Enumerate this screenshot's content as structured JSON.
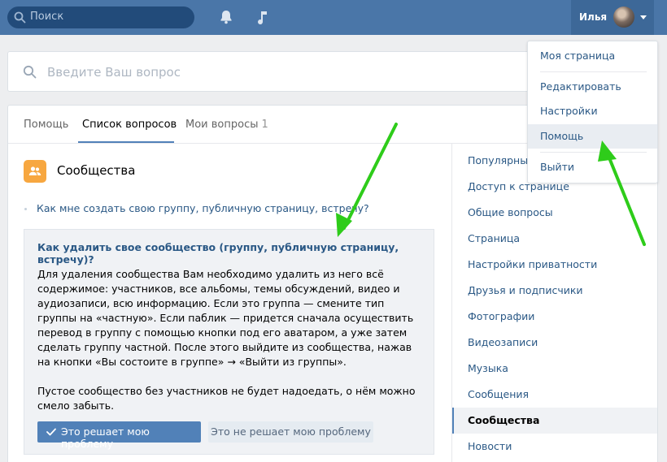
{
  "topbar": {
    "search_placeholder": "Поиск",
    "user_name": "Илья",
    "bg_color": "#4a76a8"
  },
  "help_search": {
    "placeholder": "Введите Ваш вопрос"
  },
  "tabs": [
    {
      "label": "Помощь",
      "active": false
    },
    {
      "label": "Список вопросов",
      "active": true
    },
    {
      "label": "Мои вопросы",
      "count": "1",
      "active": false
    }
  ],
  "section": {
    "title": "Сообщества",
    "question_link": "Как мне создать свою группу, публичную страницу, встречу?"
  },
  "answer": {
    "title": "Как удалить свое сообщество (группу, публичную страницу, встречу)?",
    "paragraph1": "Для удаления сообщества Вам необходимо удалить из него всё содержимое: участников, все альбомы, темы обсуждений, видео и аудиозаписи, всю информацию. Если это группа — смените тип группы на «частную». Если паблик — придется сначала осуществить перевод в группу с помощью кнопки под его аватаром, а уже затем сделать группу частной. После этого выйдите из сообщества, нажав на кнопки «Вы состоите в группе» → «Выйти из группы».",
    "paragraph2": "Пустое сообщество без участников не будет надоедать, о нём можно смело забыть.",
    "btn_yes": "Это решает мою проблему",
    "btn_no": "Это не решает мою проблему"
  },
  "side_menu": [
    "Популярные",
    "Доступ к странице",
    "Общие вопросы",
    "Страница",
    "Настройки приватности",
    "Друзья и подписчики",
    "Фотографии",
    "Видеозаписи",
    "Музыка",
    "Сообщения",
    "Сообщества",
    "Новости"
  ],
  "side_menu_active": "Сообщества",
  "dropdown": [
    "Моя страница",
    "Редактировать",
    "Настройки",
    "Помощь",
    "Выйти"
  ],
  "dropdown_hover": "Помощь",
  "colors": {
    "accent": "#5181b8",
    "link": "#2a5885",
    "arrow": "#2ecc1a",
    "section_icon": "#f7a740"
  }
}
